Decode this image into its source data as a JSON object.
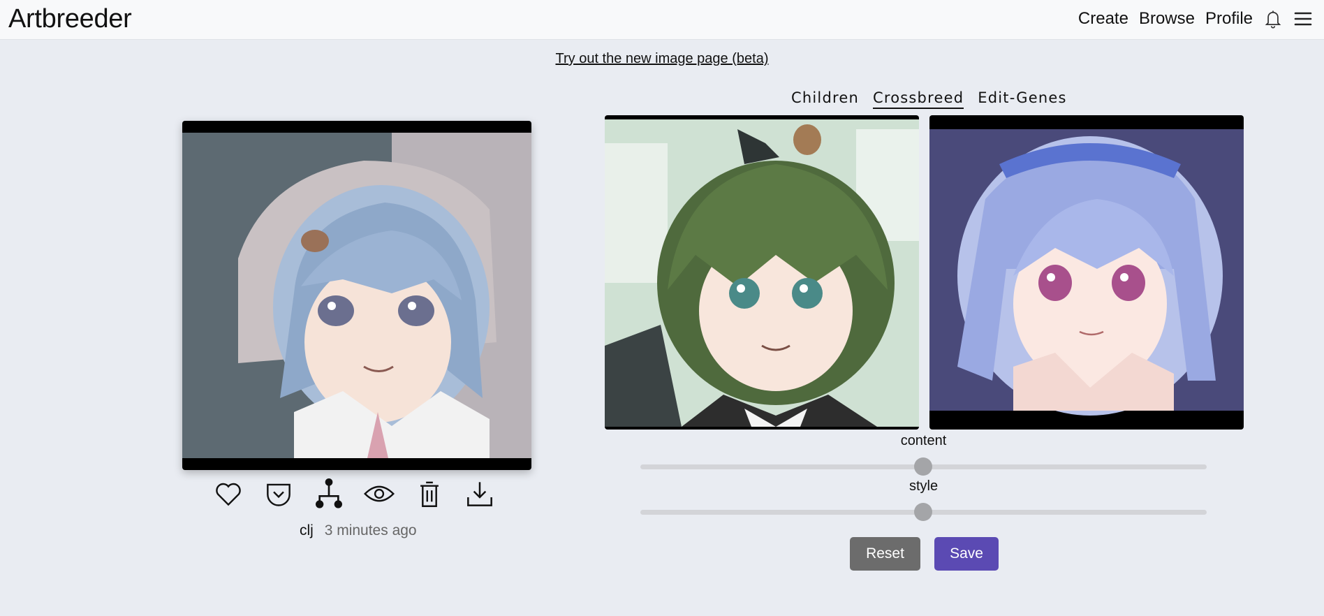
{
  "header": {
    "brand": "Artbreeder",
    "nav": {
      "create": "Create",
      "browse": "Browse",
      "profile": "Profile"
    },
    "icons": [
      "bell-icon",
      "menu-icon"
    ]
  },
  "banner": {
    "link_text": "Try out the new image page (beta)"
  },
  "image_card": {
    "actions": [
      "heart-icon",
      "pocket-icon",
      "family-tree-icon",
      "eye-icon",
      "trash-icon",
      "download-icon"
    ],
    "username": "clj",
    "timestamp": "3 minutes ago"
  },
  "tabs": [
    {
      "label": "Children",
      "active": false
    },
    {
      "label": "Crossbreed",
      "active": true
    },
    {
      "label": "Edit-Genes",
      "active": false
    }
  ],
  "sliders": {
    "content": {
      "label": "content",
      "value": 0.5
    },
    "style": {
      "label": "style",
      "value": 0.5
    }
  },
  "buttons": {
    "reset": "Reset",
    "save": "Save"
  },
  "colors": {
    "background": "#e9ecf2",
    "save_button": "#5b4ab3",
    "reset_button": "#6c6c6c",
    "slider_thumb": "#a4a5a8"
  }
}
